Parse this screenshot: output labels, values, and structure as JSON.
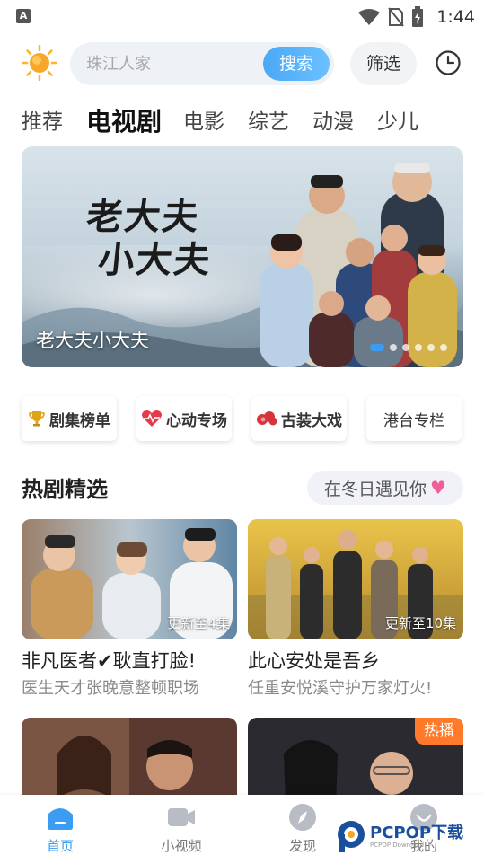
{
  "status_bar": {
    "time": "1:44",
    "notification_glyph": "A"
  },
  "header": {
    "search_placeholder": "珠江人家",
    "search_button": "搜索",
    "filter_button": "筛选"
  },
  "tabs": [
    {
      "label": "推荐",
      "active": false
    },
    {
      "label": "电视剧",
      "active": true
    },
    {
      "label": "电影",
      "active": false
    },
    {
      "label": "综艺",
      "active": false
    },
    {
      "label": "动漫",
      "active": false
    },
    {
      "label": "少儿",
      "active": false
    }
  ],
  "banner": {
    "title": "老大夫小大夫",
    "calligraphy_line1": "老大夫",
    "calligraphy_line2": "小大夫",
    "slide_count": 6,
    "active_slide": 1
  },
  "chips": [
    {
      "label": "剧集榜单",
      "icon": "trophy-icon"
    },
    {
      "label": "心动专场",
      "icon": "heartbeat-icon"
    },
    {
      "label": "古装大戏",
      "icon": "cloud-ornament-icon"
    },
    {
      "label": "港台专栏",
      "icon": ""
    }
  ],
  "section": {
    "title": "热剧精选",
    "tag": "在冬日遇见你"
  },
  "cards": [
    {
      "title": "非凡医者✔耿直打脸!",
      "subtitle": "医生天才张晚意整顿职场",
      "badge": "更新至4集"
    },
    {
      "title": "此心安处是吾乡",
      "subtitle": "任重安悦溪守护万家灯火!",
      "badge": "更新至10集"
    },
    {
      "title": "",
      "subtitle": "",
      "badge": ""
    },
    {
      "title": "",
      "subtitle": "",
      "badge": "热播"
    }
  ],
  "bottom_nav": [
    {
      "label": "首页",
      "icon": "home-icon",
      "active": true
    },
    {
      "label": "小视频",
      "icon": "video-icon",
      "active": false
    },
    {
      "label": "发现",
      "icon": "compass-icon",
      "active": false
    },
    {
      "label": "我的",
      "icon": "profile-icon",
      "active": false
    }
  ],
  "watermark": {
    "text": "PCPOP下载",
    "small": "PCPOP Download"
  },
  "colors": {
    "accent": "#3a9cf2",
    "hot": "#ff7a2a",
    "heart": "#f05f9a"
  }
}
